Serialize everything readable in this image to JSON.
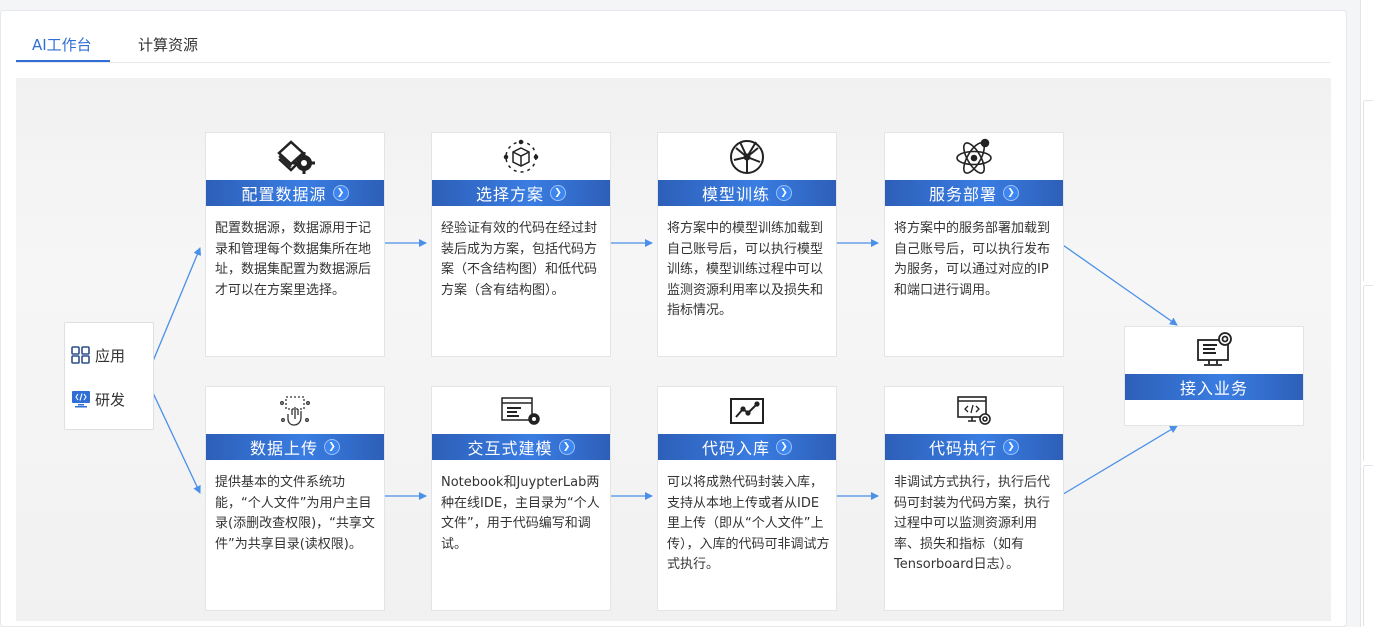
{
  "tabs": [
    {
      "label": "AI工作台",
      "active": true
    },
    {
      "label": "计算资源",
      "active": false
    }
  ],
  "side_menu": [
    {
      "label": "应用",
      "icon": "grid-icon"
    },
    {
      "label": "研发",
      "icon": "monitor-code-icon"
    }
  ],
  "cards": [
    {
      "title": "配置数据源",
      "icon": "database-gear-icon",
      "desc": "配置数据源，数据源用于记录和管理每个数据集所在地址，数据集配置为数据源后才可以在方案里选择。"
    },
    {
      "title": "选择方案",
      "icon": "cube-icon",
      "desc": "经验证有效的代码在经过封装后成为方案，包括代码方案（不含结构图）和低代码方案（含有结构图）。"
    },
    {
      "title": "模型训练",
      "icon": "network-sphere-icon",
      "desc": "将方案中的模型训练加载到自己账号后，可以执行模型训练，模型训练过程中可以监测资源利用率以及损失和指标情况。"
    },
    {
      "title": "服务部署",
      "icon": "atom-icon",
      "desc": "将方案中的服务部署加载到自己账号后，可以执行发布为服务，可以通过对应的IP和端口进行调用。"
    },
    {
      "title": "数据上传",
      "icon": "touch-upload-icon",
      "desc": "提供基本的文件系统功能，“个人文件”为用户主目录(添删改查权限)，“共享文件”为共享目录(读权限)。"
    },
    {
      "title": "交互式建模",
      "icon": "code-window-icon",
      "desc": "Notebook和JuypterLab两种在线IDE，主目录为“个人文件”，用于代码编写和调试。"
    },
    {
      "title": "代码入库",
      "icon": "line-chart-icon",
      "desc": "可以将成熟代码封装入库，支持从本地上传或者从IDE里上传（即从“个人文件”上传），入库的代码可非调试方式执行。"
    },
    {
      "title": "代码执行",
      "icon": "monitor-gear-icon",
      "desc": "非调试方式执行，执行后代码可封装为代码方案，执行过程中可以监测资源利用率、损失和指标（如有Tensorboard日志）。"
    }
  ],
  "final": {
    "title": "接入业务",
    "icon": "monitor-settings-icon"
  },
  "colors": {
    "accent": "#2f6fd6",
    "bar": "#2d5fb8",
    "arrow": "#4a90e8"
  }
}
